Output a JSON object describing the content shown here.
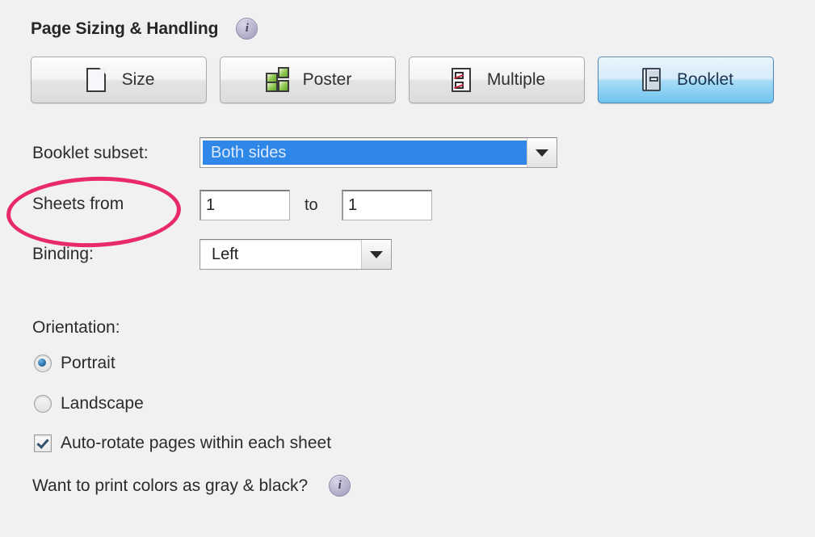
{
  "header": {
    "title": "Page Sizing & Handling",
    "info_icon": "info-icon"
  },
  "mode_buttons": [
    {
      "label": "Size",
      "icon": "page-resize-icon",
      "selected": false
    },
    {
      "label": "Poster",
      "icon": "poster-tiles-icon",
      "selected": false
    },
    {
      "label": "Multiple",
      "icon": "multiple-pages-icon",
      "selected": false
    },
    {
      "label": "Booklet",
      "icon": "booklet-icon",
      "selected": true
    }
  ],
  "fields": {
    "booklet_subset": {
      "label": "Booklet subset:",
      "value": "Both sides",
      "selected_text": true
    },
    "sheets": {
      "label": "Sheets from",
      "from_value": "1",
      "to_label": "to",
      "to_value": "1"
    },
    "binding": {
      "label": "Binding:",
      "value": "Left"
    }
  },
  "orientation": {
    "label": "Orientation:",
    "options": [
      {
        "label": "Portrait",
        "checked": true
      },
      {
        "label": "Landscape",
        "checked": false
      }
    ]
  },
  "auto_rotate": {
    "label": "Auto-rotate pages within each sheet",
    "checked": true
  },
  "gray_black": {
    "label": "Want to print colors as gray & black?",
    "info_icon": "info-icon"
  },
  "annotation": {
    "shape": "ellipse",
    "color": "#e8296a",
    "target": "Sheets from"
  },
  "colors": {
    "background": "#f1f1f1",
    "selected_button_border": "#4d86ba",
    "selection_highlight": "#2f88e8",
    "annotation": "#e8296a",
    "text": "#2b2b2b"
  }
}
